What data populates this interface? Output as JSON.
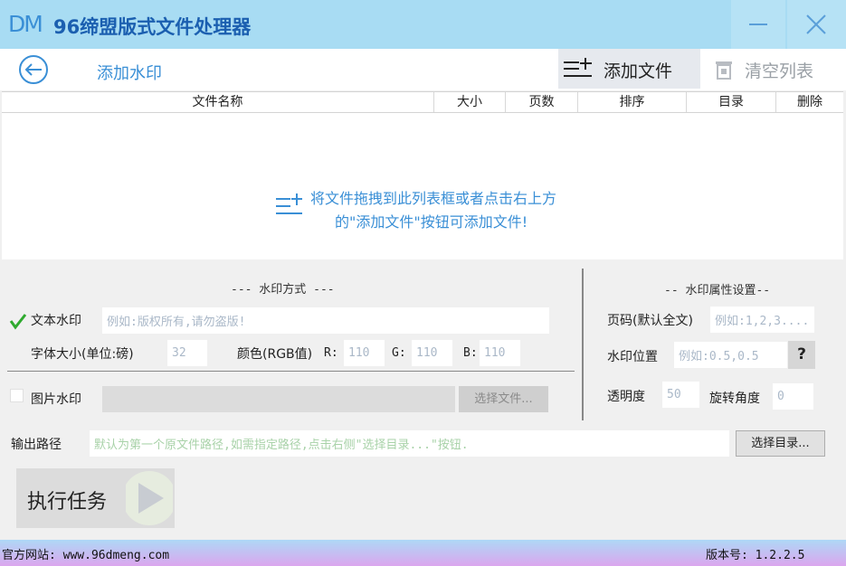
{
  "window": {
    "logo_text": "DM",
    "title": "96缔盟版式文件处理器"
  },
  "toolbar": {
    "page_title": "添加水印",
    "add_file_label": "添加文件",
    "clear_list_label": "清空列表"
  },
  "table": {
    "columns": [
      "文件名称",
      "大小",
      "页数",
      "排序",
      "目录",
      "删除"
    ],
    "empty_hint_line1": "将文件拖拽到此列表框或者点击右上方",
    "empty_hint_line2": "的\"添加文件\"按钮可添加文件!"
  },
  "watermark_mode": {
    "section_title": "--- 水印方式 ---",
    "text_watermark_label": "文本水印",
    "text_watermark_checked": true,
    "text_placeholder": "例如:版权所有,请勿盗版!",
    "font_size_label": "字体大小(单位:磅)",
    "font_size_value": "32",
    "color_label": "颜色(RGB值)",
    "r_label": "R:",
    "r_value": "110",
    "g_label": "G:",
    "g_value": "110",
    "b_label": "B:",
    "b_value": "110",
    "image_watermark_label": "图片水印",
    "image_watermark_checked": false,
    "select_file_button": "选择文件..."
  },
  "watermark_props": {
    "section_title": "-- 水印属性设置--",
    "page_label": "页码(默认全文)",
    "page_placeholder": "例如:1,2,3....",
    "position_label": "水印位置",
    "position_placeholder": "例如:0.5,0.5",
    "help_button": "?",
    "opacity_label": "透明度",
    "opacity_value": "50",
    "rotation_label": "旋转角度",
    "rotation_value": "0"
  },
  "output": {
    "label": "输出路径",
    "placeholder": "默认为第一个原文件路径,如需指定路径,点击右侧\"选择目录...\"按钮.",
    "select_dir_button": "选择目录..."
  },
  "run": {
    "label": "执行任务"
  },
  "footer": {
    "website": "官方网站: www.96dmeng.com",
    "version": "版本号: 1.2.2.5"
  },
  "colors": {
    "title_bar": "#a8dcf3",
    "accent": "#3a8fd6",
    "check_green": "#2faa2f"
  }
}
